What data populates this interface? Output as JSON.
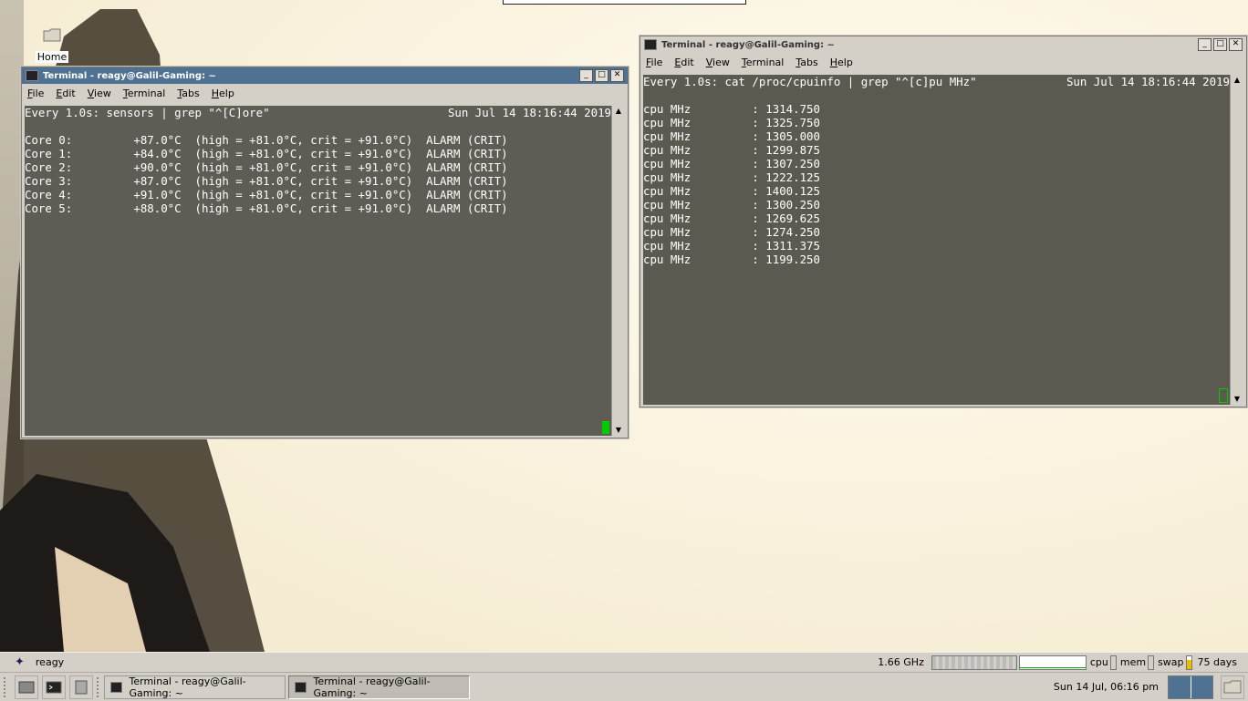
{
  "desktop": {
    "home_label": "Home"
  },
  "window_left": {
    "title": "Terminal - reagy@Galil-Gaming: ~",
    "menu": [
      "File",
      "Edit",
      "View",
      "Terminal",
      "Tabs",
      "Help"
    ],
    "header_cmd": "Every 1.0s: sensors | grep \"^[C]ore\"",
    "header_time": "Sun Jul 14 18:16:44 2019",
    "lines": [
      "Core 0:         +87.0°C  (high = +81.0°C, crit = +91.0°C)  ALARM (CRIT)",
      "Core 1:         +84.0°C  (high = +81.0°C, crit = +91.0°C)  ALARM (CRIT)",
      "Core 2:         +90.0°C  (high = +81.0°C, crit = +91.0°C)  ALARM (CRIT)",
      "Core 3:         +87.0°C  (high = +81.0°C, crit = +91.0°C)  ALARM (CRIT)",
      "Core 4:         +91.0°C  (high = +81.0°C, crit = +91.0°C)  ALARM (CRIT)",
      "Core 5:         +88.0°C  (high = +81.0°C, crit = +91.0°C)  ALARM (CRIT)"
    ]
  },
  "window_right": {
    "title": "Terminal - reagy@Galil-Gaming: ~",
    "menu": [
      "File",
      "Edit",
      "View",
      "Terminal",
      "Tabs",
      "Help"
    ],
    "header_cmd": "Every 1.0s: cat /proc/cpuinfo | grep \"^[c]pu MHz\"",
    "header_time": "Sun Jul 14 18:16:44 2019",
    "lines": [
      "cpu MHz         : 1314.750",
      "cpu MHz         : 1325.750",
      "cpu MHz         : 1305.000",
      "cpu MHz         : 1299.875",
      "cpu MHz         : 1307.250",
      "cpu MHz         : 1222.125",
      "cpu MHz         : 1400.125",
      "cpu MHz         : 1300.250",
      "cpu MHz         : 1269.625",
      "cpu MHz         : 1274.250",
      "cpu MHz         : 1311.375",
      "cpu MHz         : 1199.250"
    ]
  },
  "panel_top": {
    "user": "reagy",
    "cpu_freq": "1.66 GHz",
    "cpu_label": "cpu",
    "mem_label": "mem",
    "swap_label": "swap",
    "uptime": "75 days"
  },
  "panel_bottom": {
    "tasks": [
      "Terminal - reagy@Galil-Gaming: ~",
      "Terminal - reagy@Galil-Gaming: ~"
    ],
    "clock": "Sun 14 Jul, 06:16 pm"
  },
  "colors": {
    "titlebar_active": "#4f7192",
    "terminal_bg": "#5b5a50",
    "panel": "#d4d0c8"
  }
}
